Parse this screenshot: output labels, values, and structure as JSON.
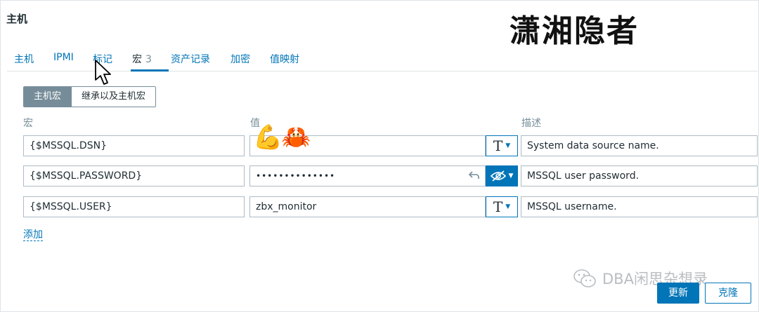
{
  "page": {
    "title": "主机"
  },
  "watermark": {
    "title": "潇湘隐者",
    "channel": "DBA闲思杂想录"
  },
  "tabs": [
    {
      "label": "主机"
    },
    {
      "label": "IPMI"
    },
    {
      "label": "标记"
    },
    {
      "label": "宏",
      "count": "3",
      "active": true
    },
    {
      "label": "资产记录"
    },
    {
      "label": "加密"
    },
    {
      "label": "值映射"
    }
  ],
  "macro_scope": {
    "host": "主机宏",
    "inherited": "继承以及主机宏",
    "selected": "主机宏"
  },
  "columns": {
    "macro": "宏",
    "value": "值",
    "description": "描述"
  },
  "macros": [
    {
      "macro": "{$MSSQL.DSN}",
      "value": "",
      "type": "text",
      "type_glyph": "T",
      "description": "System data source name."
    },
    {
      "macro": "{$MSSQL.PASSWORD}",
      "value": "••••••••••••••",
      "type": "secret",
      "description": "MSSQL user password."
    },
    {
      "macro": "{$MSSQL.USER}",
      "value": "zbx_monitor",
      "type": "text",
      "type_glyph": "T",
      "description": "MSSQL username."
    }
  ],
  "add_link": "添加",
  "emoji": {
    "arm": "💪",
    "crab": "🦀"
  },
  "actions": {
    "update": "更新",
    "clone": "克隆"
  },
  "colors": {
    "accent": "#0275b8",
    "muted": "#768d99",
    "border": "#adbbc4"
  }
}
